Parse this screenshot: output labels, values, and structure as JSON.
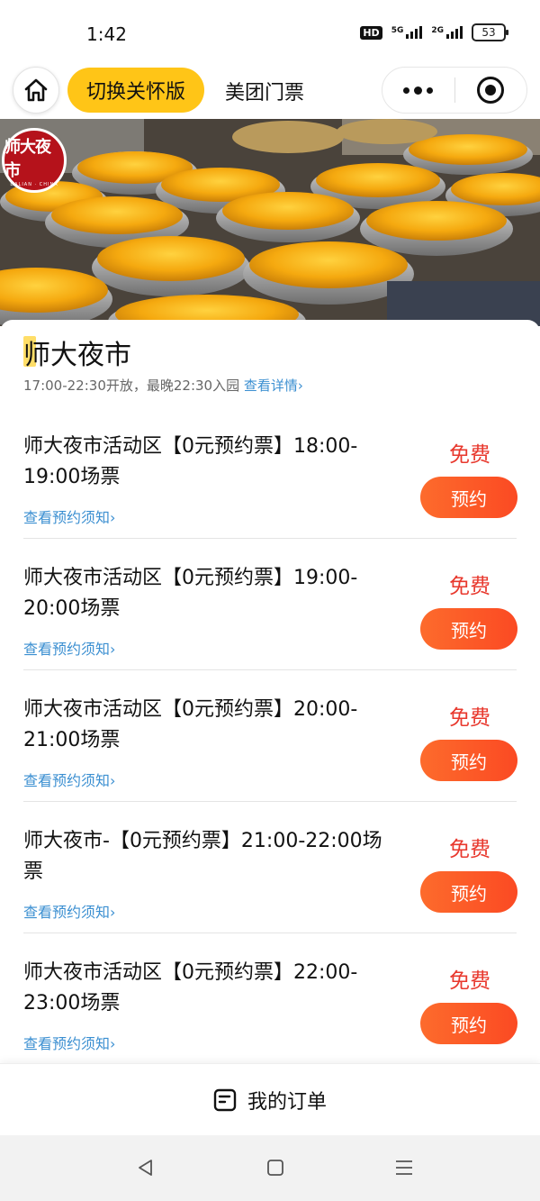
{
  "status_bar": {
    "time": "1:42",
    "hd_badge": "HD",
    "network_1": "5G",
    "network_2": "2G",
    "battery": "53"
  },
  "nav": {
    "home_icon": "home-icon",
    "care_mode_label": "切换关怀版",
    "title": "美团门票",
    "more_icon": "more-dots-icon",
    "close_icon": "target-icon"
  },
  "banner": {
    "logo_text": "师大夜市",
    "logo_subtext": "DALIAN · CHINA"
  },
  "venue": {
    "name": "师大夜市",
    "hours": "17:00-22:30开放，最晚22:30入园",
    "details_link": "查看详情"
  },
  "tickets": [
    {
      "name": "师大夜市活动区【0元预约票】18:00-19:00场票",
      "notice": "查看预约须知",
      "price": "免费",
      "button": "预约"
    },
    {
      "name": "师大夜市活动区【0元预约票】19:00-20:00场票",
      "notice": "查看预约须知",
      "price": "免费",
      "button": "预约"
    },
    {
      "name": "师大夜市活动区【0元预约票】20:00-21:00场票",
      "notice": "查看预约须知",
      "price": "免费",
      "button": "预约"
    },
    {
      "name": "师大夜市-【0元预约票】21:00-22:00场票",
      "notice": "查看预约须知",
      "price": "免费",
      "button": "预约"
    },
    {
      "name": "师大夜市活动区【0元预约票】22:00-23:00场票",
      "notice": "查看预约须知",
      "price": "免费",
      "button": "预约"
    }
  ],
  "order_bar": {
    "icon": "order-list-icon",
    "label": "我的订单"
  },
  "system_nav": {
    "back_icon": "back-triangle-icon",
    "home_icon": "square-home-icon",
    "menu_icon": "menu-lines-icon"
  },
  "colors": {
    "care_button": "#ffc517",
    "price_red": "#e8382d",
    "book_button": "#fb4a23",
    "link_blue": "#3b8fd1",
    "logo_red": "#b5121b"
  }
}
